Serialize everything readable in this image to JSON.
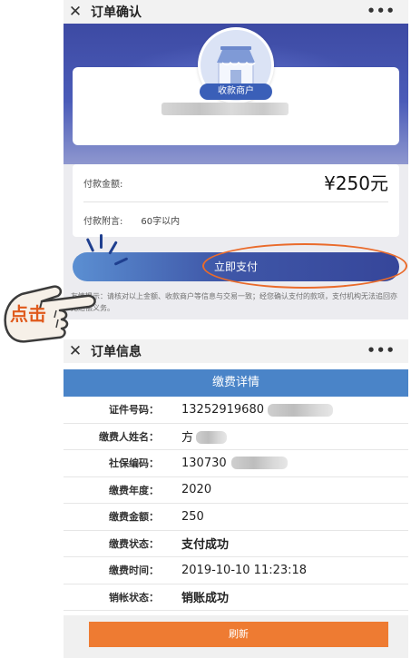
{
  "order_confirm": {
    "close_icon": "✕",
    "title": "订单确认",
    "more_icon": "•••",
    "merchant_badge": "收款商户",
    "amount_label": "付款金额:",
    "amount_value": "¥250元",
    "note_label": "付款附言:",
    "note_placeholder": "60字以内",
    "pay_button": "立即支付",
    "tip_text": "友情提示：请核对以上金额、收款商户等信息与交易一致；经您确认支付的款项，支付机构无法追回亦无赔偿义务。"
  },
  "annotation": {
    "click_label": "点击",
    "highlight_color": "#ea6b2b"
  },
  "order_info": {
    "close_icon": "✕",
    "title": "订单信息",
    "more_icon": "•••",
    "section_title": "缴费详情",
    "rows": [
      {
        "label": "证件号码：",
        "value": "13252919680"
      },
      {
        "label": "缴费人姓名：",
        "value": "方"
      },
      {
        "label": "社保编码：",
        "value": "130730"
      },
      {
        "label": "缴费年度：",
        "value": "2020"
      },
      {
        "label": "缴费金额：",
        "value": "250"
      },
      {
        "label": "缴费状态：",
        "value": "支付成功"
      },
      {
        "label": "缴费时间：",
        "value": "2019-10-10 11:23:18"
      },
      {
        "label": "销帐状态：",
        "value": "销账成功"
      }
    ],
    "refresh_button": "刷新"
  },
  "colors": {
    "banner": "#4a5bb8",
    "section_header": "#4a84c8",
    "refresh_button": "#ee7b32"
  }
}
